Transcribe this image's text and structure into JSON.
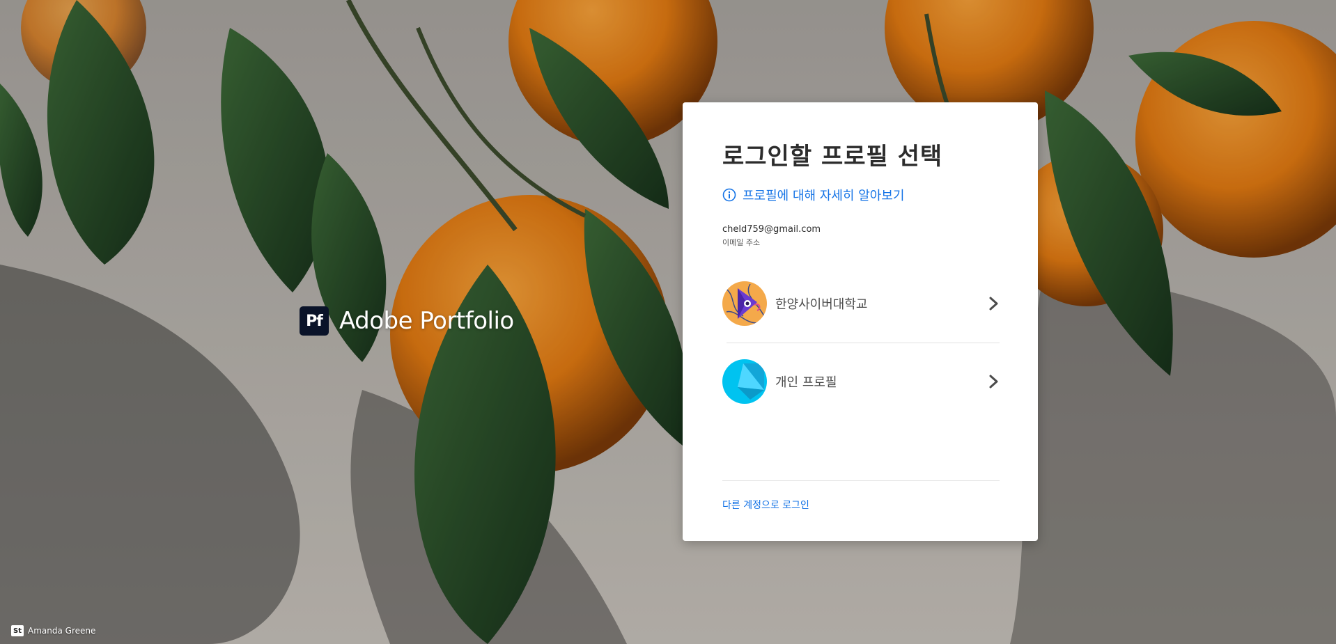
{
  "brand": {
    "mark": "Pf",
    "name": "Adobe Portfolio"
  },
  "card": {
    "title": "로그인할 프로필 선택",
    "learn_more_link": "프로필에 대해 자세히 알아보기",
    "email": {
      "value": "cheld759@gmail.com",
      "label": "이메일 주소"
    },
    "profiles": [
      {
        "name": "한양사이버대학교",
        "avatar_icon": "purple-ribbon-avatar"
      },
      {
        "name": "개인 프로필",
        "avatar_icon": "cyan-shape-avatar"
      }
    ],
    "other_account_link": "다른 계정으로 로그인"
  },
  "credit": {
    "mark": "St",
    "name": "Amanda Greene"
  },
  "colors": {
    "link": "#1473e6",
    "card_bg": "#ffffff",
    "brand_mark_bg": "#0a1329",
    "personal_avatar": "#00c3f0"
  }
}
